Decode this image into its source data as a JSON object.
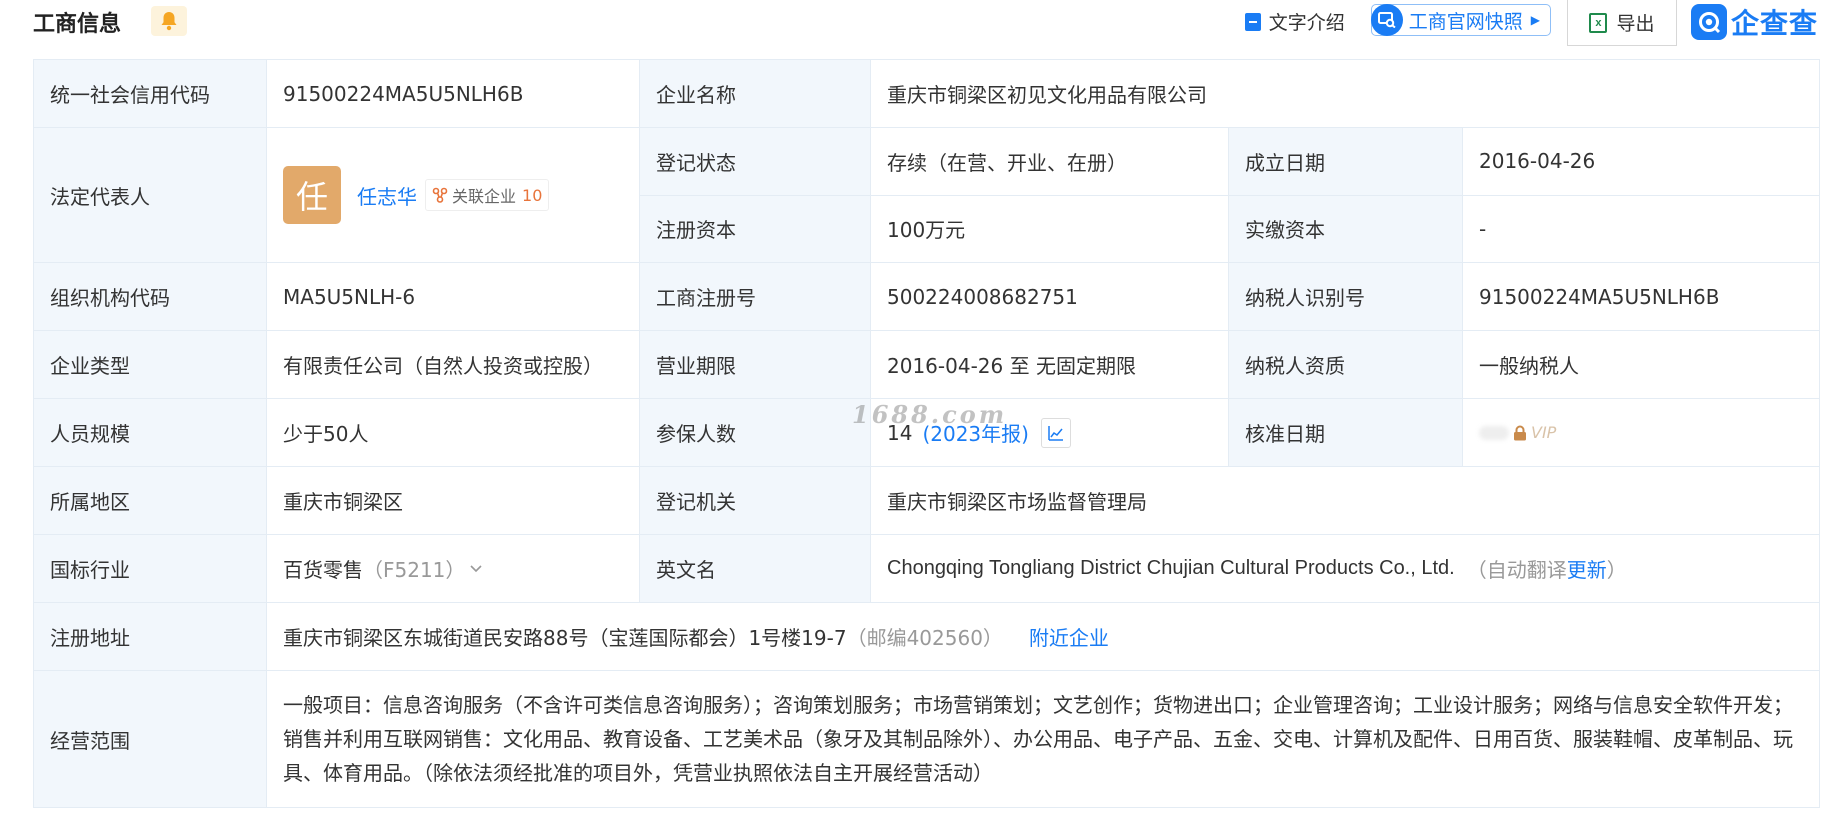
{
  "header": {
    "title": "工商信息",
    "text_intro": "文字介绍",
    "snapshot": "工商官网快照",
    "export": "导出",
    "brand": "企查查"
  },
  "rows": {
    "credit_code_label": "统一社会信用代码",
    "credit_code": "91500224MA5U5NLH6B",
    "company_name_label": "企业名称",
    "company_name": "重庆市铜梁区初见文化用品有限公司",
    "legal_rep_label": "法定代表人",
    "legal_rep_avatar": "任",
    "legal_rep_name": "任志华",
    "related_label": "关联企业",
    "related_count": "10",
    "reg_status_label": "登记状态",
    "reg_status": "存续（在营、开业、在册）",
    "founded_label": "成立日期",
    "founded": "2016-04-26",
    "reg_capital_label": "注册资本",
    "reg_capital": "100万元",
    "paid_capital_label": "实缴资本",
    "paid_capital": "-",
    "org_code_label": "组织机构代码",
    "org_code": "MA5U5NLH-6",
    "biz_reg_no_label": "工商注册号",
    "biz_reg_no": "500224008682751",
    "taxpayer_id_label": "纳税人识别号",
    "taxpayer_id": "91500224MA5U5NLH6B",
    "company_type_label": "企业类型",
    "company_type": "有限责任公司（自然人投资或控股）",
    "biz_term_label": "营业期限",
    "biz_term": "2016-04-26 至 无固定期限",
    "taxpayer_qual_label": "纳税人资质",
    "taxpayer_qual": "一般纳税人",
    "staff_size_label": "人员规模",
    "staff_size": "少于50人",
    "insured_label": "参保人数",
    "insured": "14",
    "insured_year": "(2023年报)",
    "approved_date_label": "核准日期",
    "approved_vip": "VIP",
    "region_label": "所属地区",
    "region": "重庆市铜梁区",
    "reg_authority_label": "登记机关",
    "reg_authority": "重庆市铜梁区市场监督管理局",
    "industry_label": "国标行业",
    "industry": "百货零售",
    "industry_code": "（F5211）",
    "english_name_label": "英文名",
    "english_name": "Chongqing Tongliang District Chujian Cultural Products Co., Ltd.",
    "auto_translate": "（自动翻译",
    "update_link": "更新",
    "close_paren": "）",
    "address_label": "注册地址",
    "address": "重庆市铜梁区东城街道民安路88号（宝莲国际都会）1号楼19-7",
    "postcode": "（邮编402560）",
    "nearby_link": "附近企业",
    "scope_label": "经营范围",
    "scope": "一般项目：信息咨询服务（不含许可类信息咨询服务）；咨询策划服务；市场营销策划；文艺创作；货物进出口；企业管理咨询；工业设计服务；网络与信息安全软件开发；销售并利用互联网销售：文化用品、教育设备、工艺美术品（象牙及其制品除外）、办公用品、电子产品、五金、交电、计算机及配件、日用百货、服装鞋帽、皮革制品、玩具、体育用品。（除依法须经批准的项目外，凭营业执照依法自主开展经营活动）"
  },
  "watermark": "1688.com",
  "colors": {
    "accent": "#1a7cf4",
    "label_bg": "#f2f7fc",
    "avatar": "#e2a96a",
    "count": "#e8743b"
  }
}
